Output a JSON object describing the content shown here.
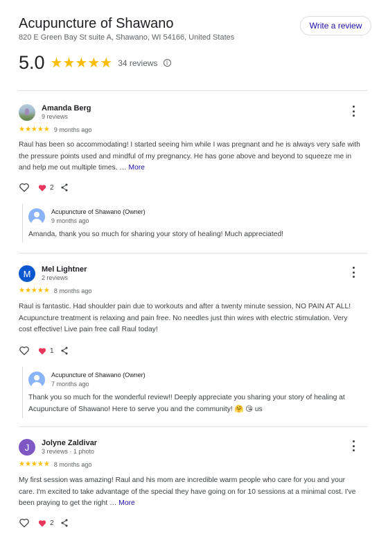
{
  "business": {
    "name": "Acupuncture of Shawano",
    "address": "820 E Green Bay St suite A, Shawano, WI 54166, United States",
    "write_review_label": "Write a review",
    "rating": "5.0",
    "stars": "★★★★★",
    "review_count_label": "34 reviews",
    "info_icon": "info-icon"
  },
  "colors": {
    "star": "#fbbc04",
    "link": "#1a0dab",
    "heart": "#e8365d",
    "avatar_mel": "#0b57d0",
    "avatar_jolyne": "#7e57c2",
    "owner_avatar": "#8ab4f8"
  },
  "reviews": [
    {
      "name": "Amanda Berg",
      "meta": "9 reviews",
      "avatar_type": "photo",
      "stars": "★★★★★",
      "date": "9 months ago",
      "text": "Raul has been so accommodating! I started seeing him while I was pregnant and he is always very safe with the pressure points used and mindful of my pregnancy. He has gone above and beyond to squeeze me in and help me out multiple times. …",
      "more_label": "More",
      "reaction_count": "2",
      "owner_reply": {
        "name": "Acupuncture of Shawano (Owner)",
        "date": "9 months ago",
        "text": "Amanda, thank you so much for sharing your story of healing! Much appreciated!"
      }
    },
    {
      "name": "Mel Lightner",
      "meta": "2 reviews",
      "avatar_letter": "M",
      "stars": "★★★★★",
      "date": "8 months ago",
      "text": "Raul is fantastic. Had shoulder pain due to workouts and after a twenty minute session, NO PAIN AT ALL! Acupuncture treatment is relaxing and pain free. No needles just thin wires with electric stimulation. Very cost effective! Live pain free call Raul today!",
      "reaction_count": "1",
      "owner_reply": {
        "name": "Acupuncture of Shawano (Owner)",
        "date": "7 months ago",
        "text": "Thank you so much for the wonderful review!! Deeply appreciate you sharing your story of healing at Acupuncture of Shawano! Here to serve you and the community! 🤗 😘 us"
      }
    },
    {
      "name": "Jolyne Zaldivar",
      "meta": "3 reviews · 1 photo",
      "avatar_letter": "J",
      "stars": "★★★★★",
      "date": "8 months ago",
      "text": "My first session was amazing! Raul and his mom are incredible warm people who care for you and your care. I'm excited to take advantage of the special they have going on for 10 sessions at a minimal cost. I've been praying to get the right …",
      "more_label": "More",
      "reaction_count": "2"
    }
  ]
}
